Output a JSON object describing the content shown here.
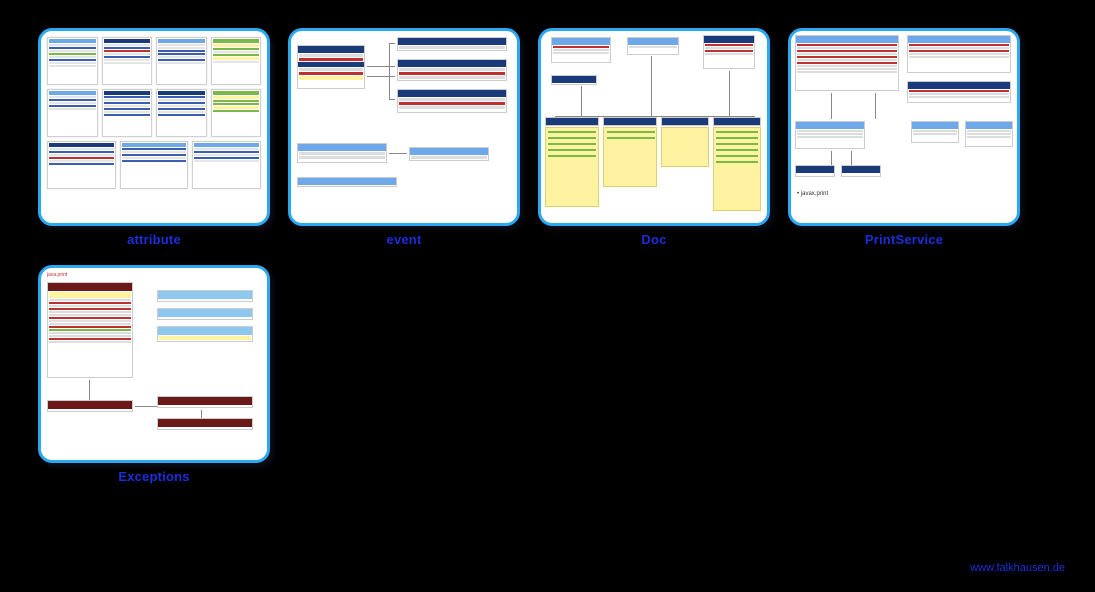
{
  "gallery": {
    "items": [
      {
        "label": "attribute"
      },
      {
        "label": "event"
      },
      {
        "label": "Doc"
      },
      {
        "label": "PrintService"
      },
      {
        "label": "Exceptions"
      }
    ]
  },
  "footer": {
    "link_text": "www.falkhausen.de"
  }
}
